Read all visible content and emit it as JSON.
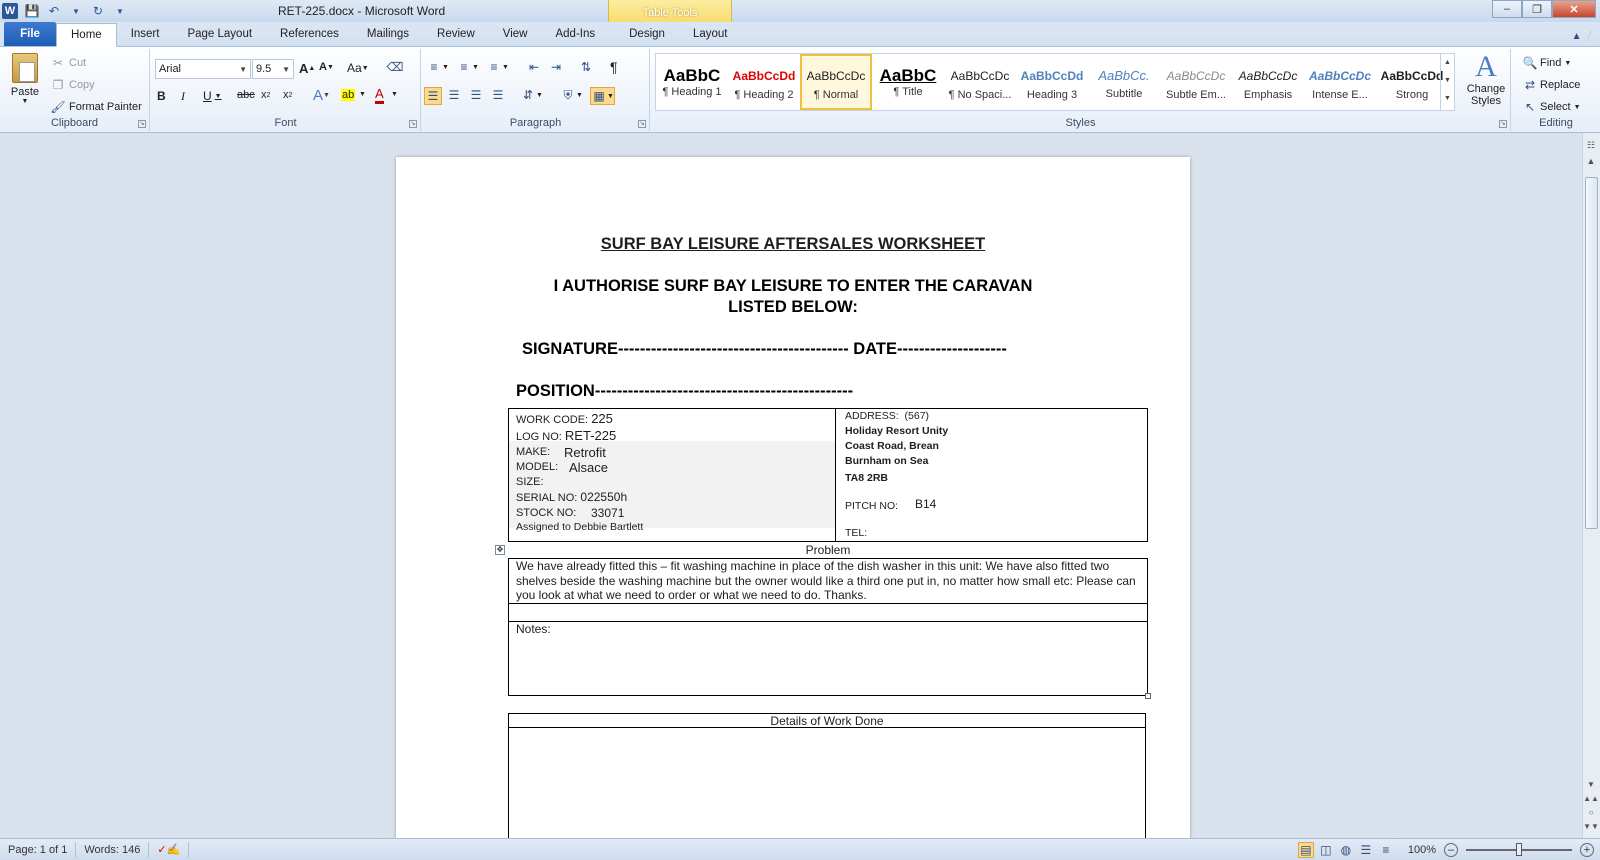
{
  "window": {
    "title": "RET-225.docx  -  Microsoft Word",
    "contextual_tab_group": "Table Tools",
    "controls": [
      "minimize",
      "restore",
      "close"
    ]
  },
  "quick_access": {
    "icons": [
      "word-icon",
      "save-icon",
      "undo-icon",
      "redo-icon",
      "customize-icon"
    ]
  },
  "tabs": [
    "File",
    "Home",
    "Insert",
    "Page Layout",
    "References",
    "Mailings",
    "Review",
    "View",
    "Add-Ins",
    "Design",
    "Layout"
  ],
  "active_tab": "Home",
  "ribbon": {
    "clipboard": {
      "label": "Clipboard",
      "paste": "Paste",
      "cut": "Cut",
      "copy": "Copy",
      "format_painter": "Format Painter"
    },
    "font": {
      "label": "Font",
      "font_name": "Arial",
      "font_size": "9.5",
      "change_case": "Aa"
    },
    "paragraph": {
      "label": "Paragraph"
    },
    "styles": {
      "label": "Styles",
      "items": [
        {
          "sample": "AaBbC",
          "name": "¶ Heading 1"
        },
        {
          "sample": "AaBbCcDd",
          "name": "¶ Heading 2"
        },
        {
          "sample": "AaBbCcDc",
          "name": "¶ Normal"
        },
        {
          "sample": "AaBbC",
          "name": "¶ Title"
        },
        {
          "sample": "AaBbCcDc",
          "name": "¶ No Spaci..."
        },
        {
          "sample": "AaBbCcDd",
          "name": "Heading 3"
        },
        {
          "sample": "AaBbCc.",
          "name": "Subtitle"
        },
        {
          "sample": "AaBbCcDc",
          "name": "Subtle Em..."
        },
        {
          "sample": "AaBbCcDc",
          "name": "Emphasis"
        },
        {
          "sample": "AaBbCcDc",
          "name": "Intense E..."
        },
        {
          "sample": "AaBbCcDd",
          "name": "Strong"
        }
      ],
      "selected": "¶ Normal",
      "change_styles": "Change Styles"
    },
    "editing": {
      "label": "Editing",
      "find": "Find",
      "replace": "Replace",
      "select": "Select"
    }
  },
  "document": {
    "title": "SURF BAY LEISURE AFTERSALES WORKSHEET",
    "authorise_line1": "I AUTHORISE SURF BAY LEISURE TO ENTER THE CARAVAN",
    "authorise_line2": "LISTED BELOW:",
    "signature_line": "SIGNATURE------------------------------------------ DATE--------------------",
    "position_line": "POSITION-----------------------------------------------",
    "info_left": {
      "work_code_label": "WORK CODE:",
      "work_code": "225",
      "log_no_label": "LOG NO:",
      "log_no": "RET-225",
      "make_label": "MAKE:",
      "make": "Retrofit",
      "model_label": "MODEL:",
      "model": "Alsace",
      "size_label": "SIZE:",
      "serial_label": "SERIAL  NO:",
      "serial": "022550h",
      "stock_label": "STOCK NO:",
      "stock": "33071",
      "assigned": "Assigned to Debbie Bartlett"
    },
    "info_right": {
      "address_label": "ADDRESS:",
      "address_code": "(567)",
      "address_line1": "Holiday Resort Unity",
      "address_line2": "Coast Road, Brean",
      "address_line3": "Burnham on Sea",
      "postcode": "TA8 2RB",
      "pitch_label": "PITCH NO:",
      "pitch": "B14",
      "tel_label": "TEL:"
    },
    "problem_header": "Problem",
    "problem_text": "We have already fitted this – fit washing machine in place of the dish washer in this unit: We have also fitted two shelves beside the washing machine but the owner would like a third one put in, no matter how small etc: Please can you look at what we need to order or what we need to do. Thanks.",
    "notes_label": "Notes:",
    "details_header": "Details of Work Done"
  },
  "status": {
    "page": "Page: 1 of 1",
    "words": "Words: 146",
    "zoom": "100%"
  },
  "colors": {
    "accent": "#2b5797",
    "file_tab": "#1f5cb5",
    "table_tools": "#f5d96a"
  }
}
